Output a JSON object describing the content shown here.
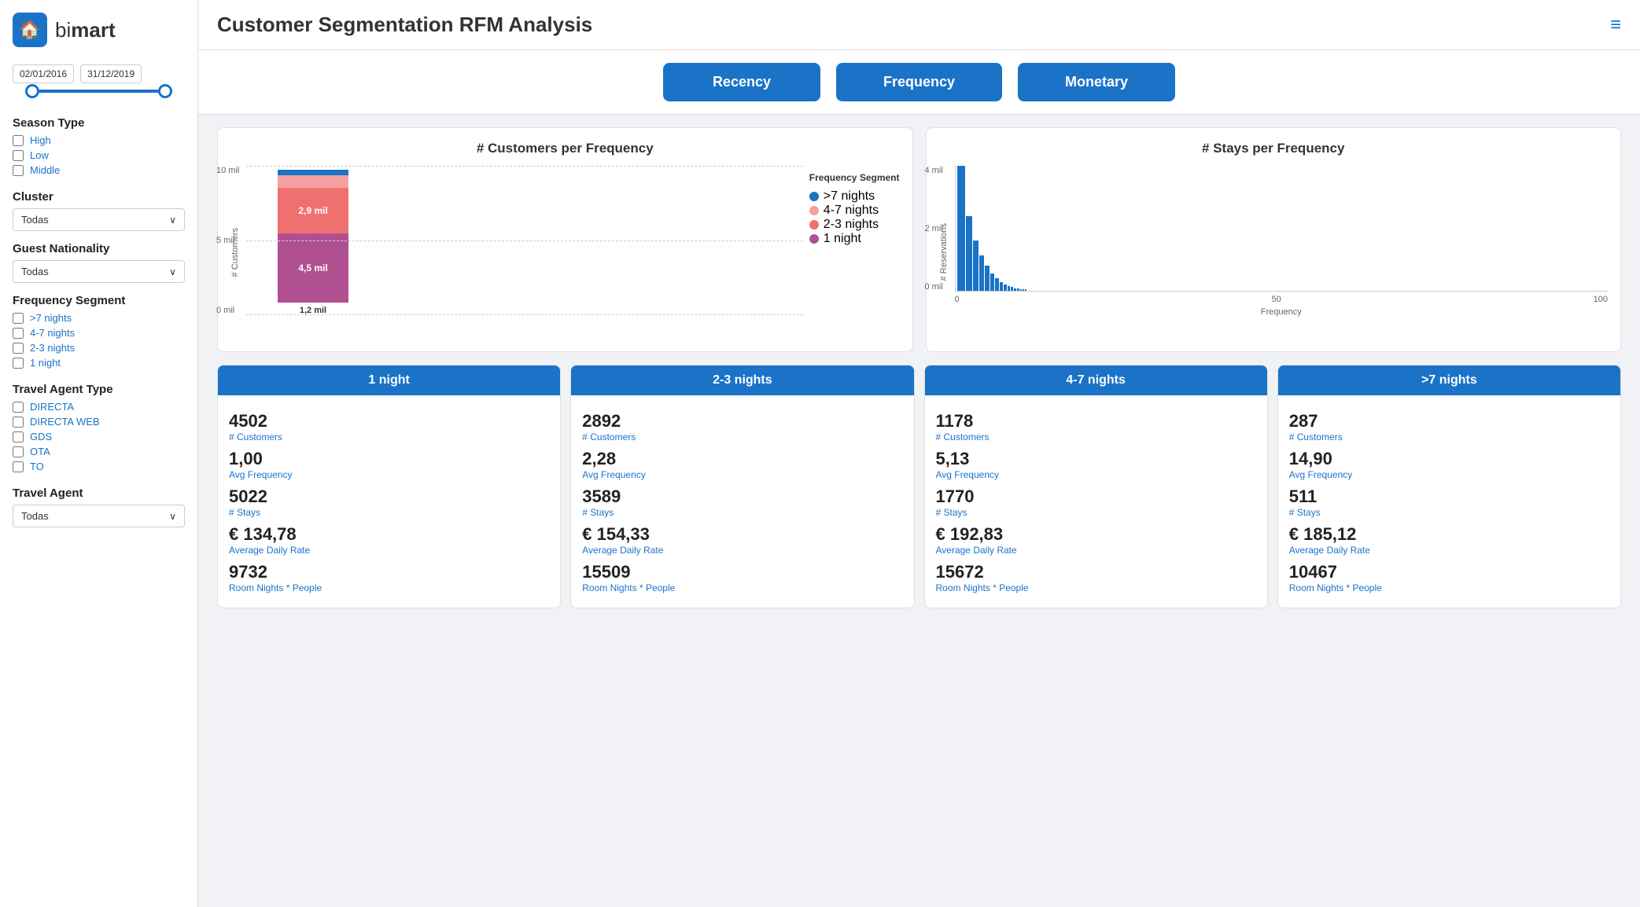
{
  "app": {
    "home_icon": "🏠",
    "logo": "bi",
    "logo_bold": "mart",
    "title_light": "Customer Segmentation",
    "title_bold": "RFM Analysis",
    "hamburger": "≡"
  },
  "sidebar": {
    "date_from": "02/01/2016",
    "date_to": "31/12/2019",
    "season_type_label": "Season Type",
    "season_options": [
      "High",
      "Low",
      "Middle"
    ],
    "cluster_label": "Cluster",
    "cluster_value": "Todas",
    "guest_nationality_label": "Guest Nationality",
    "guest_nationality_value": "Todas",
    "frequency_segment_label": "Frequency Segment",
    "frequency_options": [
      ">7 nights",
      "4-7 nights",
      "2-3 nights",
      "1 night"
    ],
    "travel_agent_type_label": "Travel Agent Type",
    "travel_agent_options": [
      "DIRECTA",
      "DIRECTA WEB",
      "GDS",
      "OTA",
      "TO"
    ],
    "travel_agent_label": "Travel Agent",
    "travel_agent_value": "Todas"
  },
  "tabs": [
    {
      "label": "Recency",
      "key": "recency"
    },
    {
      "label": "Frequency",
      "key": "frequency"
    },
    {
      "label": "Monetary",
      "key": "monetary"
    }
  ],
  "charts": {
    "left_title": "# Customers per Frequency",
    "left_y_label": "# Customers",
    "left_y_ticks": [
      "10 mil",
      "5 mil",
      "0 mil"
    ],
    "bar_segments": [
      {
        "label": ">7 nights",
        "value": "",
        "color": "#1a73c7",
        "height_pct": 5
      },
      {
        "label": "4-7 nights",
        "value": "",
        "color": "#f4a0a0",
        "height_pct": 10
      },
      {
        "label": "2-3 nights",
        "value": "2,9 mil",
        "color": "#f47070",
        "height_pct": 32
      },
      {
        "label": "1 night",
        "value": "4,5 mil",
        "color": "#c060a0",
        "height_pct": 45
      }
    ],
    "bar_label_bottom": "1,2 mil",
    "legend_title": "Frequency Segment",
    "legend_items": [
      {
        "label": ">7 nights",
        "color": "#1a73c7"
      },
      {
        "label": "4-7 nights",
        "color": "#f4a0a0"
      },
      {
        "label": "2-3 nights",
        "color": "#f47070"
      },
      {
        "label": "1 night",
        "color": "#c060a0"
      }
    ],
    "right_title": "# Stays per Frequency",
    "right_y_label": "# Reservations",
    "right_y_ticks": [
      "4 mil",
      "2 mil",
      "0 mil"
    ],
    "right_x_label": "Frequency",
    "right_x_ticks": [
      "0",
      "50",
      "100"
    ]
  },
  "segments": [
    {
      "header": "1 night",
      "customers_value": "4502",
      "customers_label": "# Customers",
      "avg_frequency_value": "1,00",
      "avg_frequency_label": "Avg Frequency",
      "stays_value": "5022",
      "stays_label": "# Stays",
      "adr_value": "€ 134,78",
      "adr_label": "Average Daily Rate",
      "room_nights_value": "9732",
      "room_nights_label": "Room Nights * People"
    },
    {
      "header": "2-3 nights",
      "customers_value": "2892",
      "customers_label": "# Customers",
      "avg_frequency_value": "2,28",
      "avg_frequency_label": "Avg Frequency",
      "stays_value": "3589",
      "stays_label": "# Stays",
      "adr_value": "€ 154,33",
      "adr_label": "Average Daily Rate",
      "room_nights_value": "15509",
      "room_nights_label": "Room Nights * People"
    },
    {
      "header": "4-7 nights",
      "customers_value": "1178",
      "customers_label": "# Customers",
      "avg_frequency_value": "5,13",
      "avg_frequency_label": "Avg Frequency",
      "stays_value": "1770",
      "stays_label": "# Stays",
      "adr_value": "€ 192,83",
      "adr_label": "Average Daily Rate",
      "room_nights_value": "15672",
      "room_nights_label": "Room Nights * People"
    },
    {
      "header": ">7 nights",
      "customers_value": "287",
      "customers_label": "# Customers",
      "avg_frequency_value": "14,90",
      "avg_frequency_label": "Avg Frequency",
      "stays_value": "511",
      "stays_label": "# Stays",
      "adr_value": "€ 185,12",
      "adr_label": "Average Daily Rate",
      "room_nights_value": "10467",
      "room_nights_label": "Room Nights * People"
    }
  ]
}
